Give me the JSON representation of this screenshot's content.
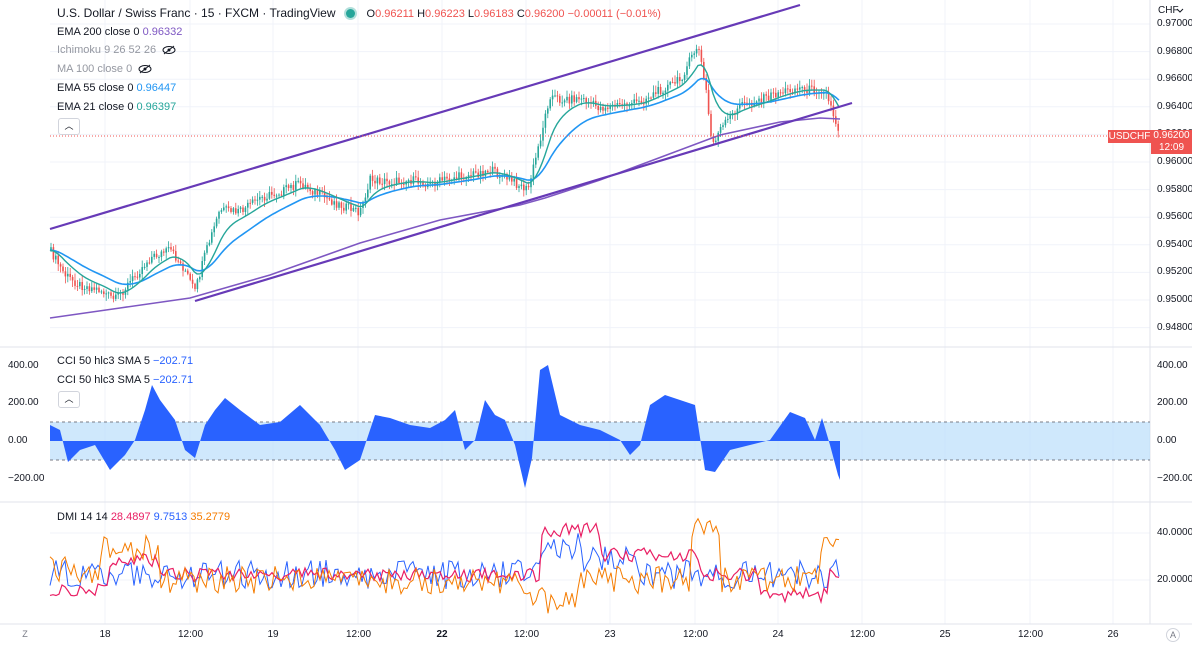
{
  "header": {
    "symbol_title": "U.S. Dollar / Swiss Franc · 15 · FXCM · TradingView",
    "ohlc": {
      "o_label": "O",
      "o": "0.96211",
      "h_label": "H",
      "h": "0.96223",
      "l_label": "L",
      "l": "0.96183",
      "c_label": "C",
      "c": "0.96200",
      "change": "−0.00011 (−0.01%)"
    }
  },
  "indicators": [
    {
      "name": "EMA 200 close 0",
      "value": "0.96332",
      "color": "#7e57c2",
      "visible": true
    },
    {
      "name": "Ichimoku 9 26 52 26",
      "value": "",
      "color": "#9598a1",
      "visible": false
    },
    {
      "name": "MA 100 close 0",
      "value": "",
      "color": "#9598a1",
      "visible": false
    },
    {
      "name": "EMA 55 close 0",
      "value": "0.96447",
      "color": "#2196f3",
      "visible": true
    },
    {
      "name": "EMA 21 close 0",
      "value": "0.96397",
      "color": "#26a69a",
      "visible": true
    }
  ],
  "cci_legends": [
    {
      "name": "CCI 50 hlc3 SMA 5",
      "value": "−202.71"
    },
    {
      "name": "CCI 50 hlc3 SMA 5",
      "value": "−202.71"
    }
  ],
  "dmi_legend": {
    "name": "DMI 14 14",
    "plus": "28.4897",
    "minus": "9.7513",
    "adx": "35.2779"
  },
  "price_axis": {
    "currency": "CHF",
    "ticks": [
      "0.97000",
      "0.96800",
      "0.96600",
      "0.96400",
      "0.96200",
      "0.96000",
      "0.95800",
      "0.95600",
      "0.95400",
      "0.95200",
      "0.95000",
      "0.94800"
    ],
    "symbol_tag": "USDCHF",
    "current_price": "0.96200",
    "countdown": "12:09"
  },
  "cci_axis": {
    "ticks_left": [
      "400.00",
      "200.00",
      "0.00",
      "−200.00"
    ],
    "ticks_right": [
      "400.00",
      "200.00",
      "0.00",
      "−200.00"
    ]
  },
  "dmi_axis": {
    "ticks": [
      "40.0000",
      "20.0000"
    ]
  },
  "time_axis": {
    "labels": [
      "18",
      "12:00",
      "19",
      "12:00",
      "22",
      "12:00",
      "23",
      "12:00",
      "24",
      "12:00",
      "25",
      "12:00",
      "26"
    ]
  },
  "corner_buttons": {
    "left": "Z",
    "right": "A"
  },
  "collapse_glyph": "︿",
  "colors": {
    "up": "#26a69a",
    "down": "#ef5350",
    "ema200": "#7e57c2",
    "ema55": "#2196f3",
    "ema21": "#26a69a",
    "channel": "#673ab7",
    "cci": "#2962ff",
    "plus_di": "#2962ff",
    "minus_di": "#e91e63",
    "adx": "#f57c00"
  }
}
